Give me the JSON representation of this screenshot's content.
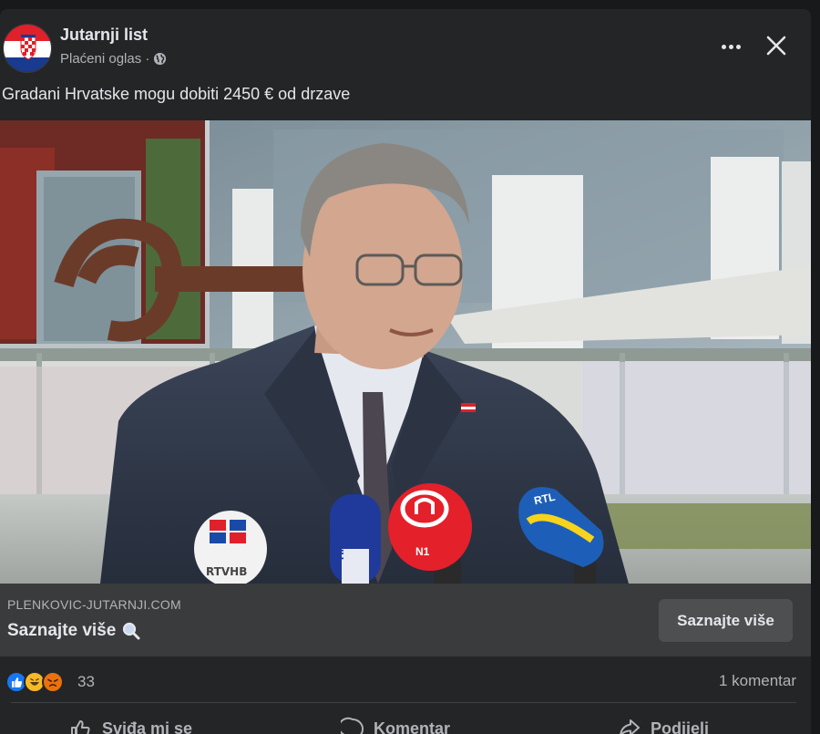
{
  "post": {
    "page_name": "Jutarnji list",
    "sponsored_label": "Plaćeni oglas ·",
    "text": "Gradani Hrvatske mogu dobiti 2450 € od drzave"
  },
  "media": {
    "mic_labels": [
      "RTVHB",
      "HRT",
      "N1",
      "RTL"
    ]
  },
  "link": {
    "domain": "PLENKOVIC-JUTARNJI.COM",
    "title": "Saznajte više",
    "cta_label": "Saznajte više"
  },
  "reactions": {
    "count": "33",
    "comments": "1 komentar",
    "types": [
      "like-icon",
      "haha-icon",
      "angry-icon"
    ]
  },
  "actions": {
    "like": "Sviđa mi se",
    "comment": "Komentar",
    "share": "Podijeli"
  },
  "colors": {
    "background": "#18191a",
    "card": "#242526",
    "link_bar": "#3a3b3c",
    "like_blue": "#1877f2",
    "haha_yellow": "#f7b928",
    "angry_red": "#e9710f"
  }
}
